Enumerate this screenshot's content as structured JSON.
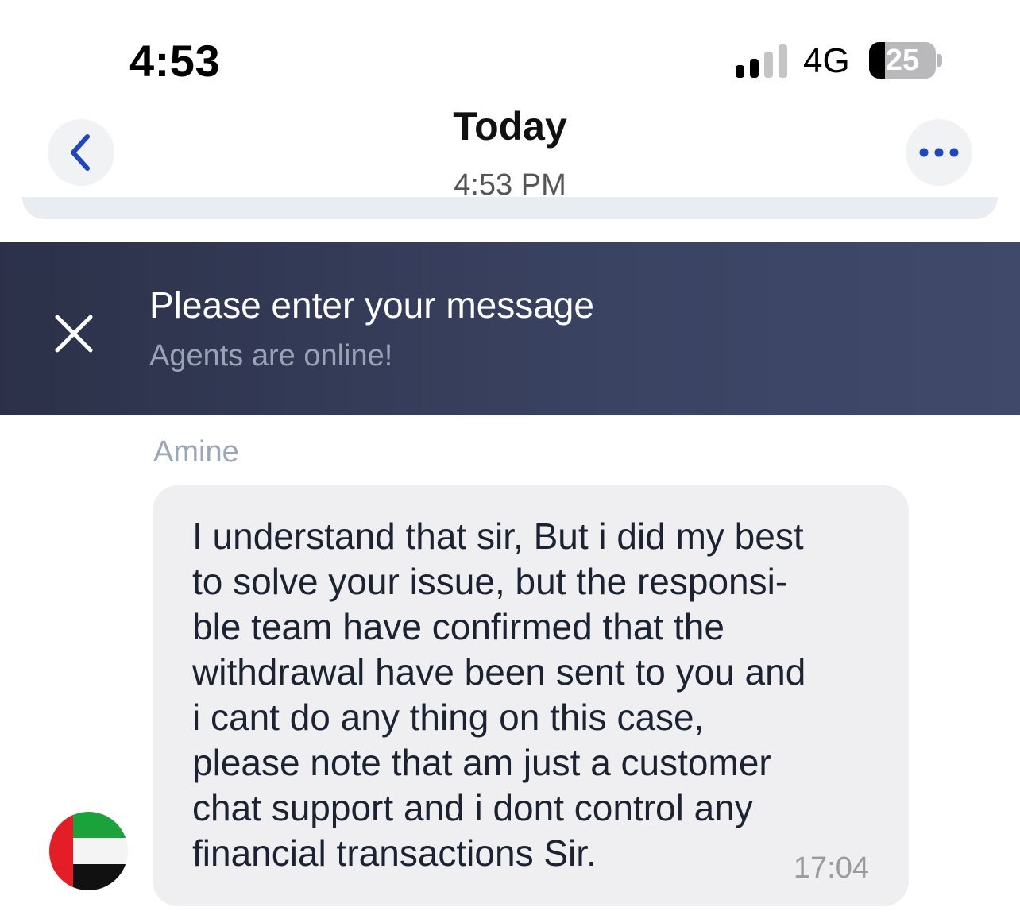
{
  "status_bar": {
    "time": "4:53",
    "network": "4G",
    "battery_level": "25",
    "signal_bars_active": 2,
    "signal_bars_total": 4
  },
  "header": {
    "title": "Today",
    "subtitle": "4:53 PM",
    "back_icon": "chevron-left-icon",
    "more_icon": "ellipsis-icon"
  },
  "banner": {
    "title": "Please enter your message",
    "subtitle": "Agents are online!",
    "close_icon": "close-icon"
  },
  "chat": {
    "messages": [
      {
        "sender": "Amine",
        "lines": [
          "I understand that sir, But i did my best",
          "to solve your issue, but the responsi-",
          "ble team have confirmed that the",
          "withdrawal have been sent to you and",
          "i cant do any thing on this case,",
          "please note that am just a customer",
          "chat support and i dont control any",
          "financial transactions Sir."
        ],
        "time": "17:04",
        "avatar": "uae-flag-avatar"
      }
    ]
  },
  "colors": {
    "accent": "#1f47c4",
    "banner_start": "#2c3149",
    "banner_end": "#41496b",
    "bubble_bg": "#efeff1",
    "sender_text": "#9aa7b8"
  }
}
